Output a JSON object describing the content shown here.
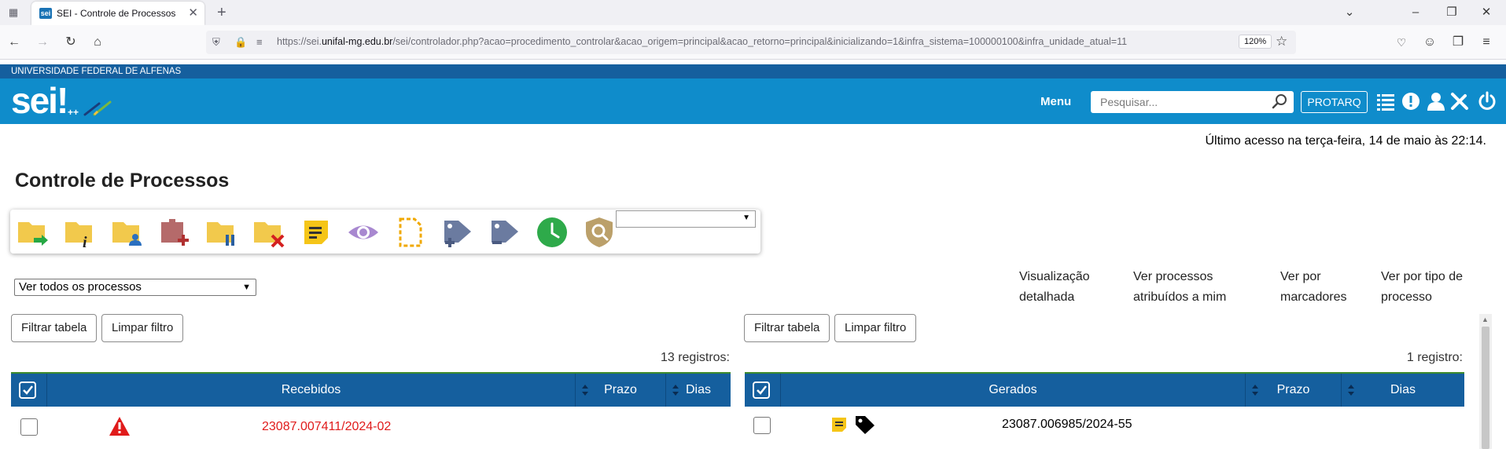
{
  "browser": {
    "tab_title": "SEI - Controle de Processos",
    "tab_favicon_text": "sei",
    "url_prefix": "https://sei.",
    "url_domain": "unifal-mg.edu.br",
    "url_rest": "/sei/controlador.php?acao=procedimento_controlar&acao_origem=principal&acao_retorno=principal&inicializando=1&infra_sistema=100000100&infra_unidade_atual=11",
    "zoom": "120%"
  },
  "header": {
    "institution": "UNIVERSIDADE FEDERAL DE ALFENAS",
    "logo_text": "sei!",
    "logo_suffix": "++",
    "menu_label": "Menu",
    "search_placeholder": "Pesquisar...",
    "unit_button": "PROTARQ",
    "bar_color": "#0f8ccb",
    "strip_color": "#155f9e"
  },
  "last_access": "Último acesso na terça-feira, 14 de maio às 22:14.",
  "page_title": "Controle de Processos",
  "toolbar": {
    "icons": [
      "folder-send-icon",
      "folder-info-icon",
      "folder-user-icon",
      "folder-add-icon",
      "folder-pause-icon",
      "folder-remove-icon",
      "note-icon",
      "eye-icon",
      "document-dashed-icon",
      "tag-add-icon",
      "tag-remove-icon",
      "clock-icon",
      "shield-search-icon"
    ],
    "select_value": ""
  },
  "filter": {
    "selected": "Ver todos os processos"
  },
  "view_links": [
    {
      "line1": "Visualização",
      "line2": "detalhada"
    },
    {
      "line1": "Ver processos",
      "line2": "atribuídos a mim"
    },
    {
      "line1": "Ver por",
      "line2": "marcadores"
    },
    {
      "line1": "Ver por tipo de",
      "line2": "processo"
    }
  ],
  "received": {
    "filter_btn": "Filtrar tabela",
    "clear_btn": "Limpar filtro",
    "count": "13 registros:",
    "col_title": "Recebidos",
    "col_deadline": "Prazo",
    "col_days": "Dias",
    "rows": [
      {
        "number": "23087.007411/2024-02",
        "color": "#e01b1b"
      }
    ]
  },
  "generated": {
    "filter_btn": "Filtrar tabela",
    "clear_btn": "Limpar filtro",
    "count": "1 registro:",
    "col_title": "Gerados",
    "col_deadline": "Prazo",
    "col_days": "Dias",
    "rows": [
      {
        "number": "23087.006985/2024-55",
        "color": "#000000"
      }
    ]
  }
}
